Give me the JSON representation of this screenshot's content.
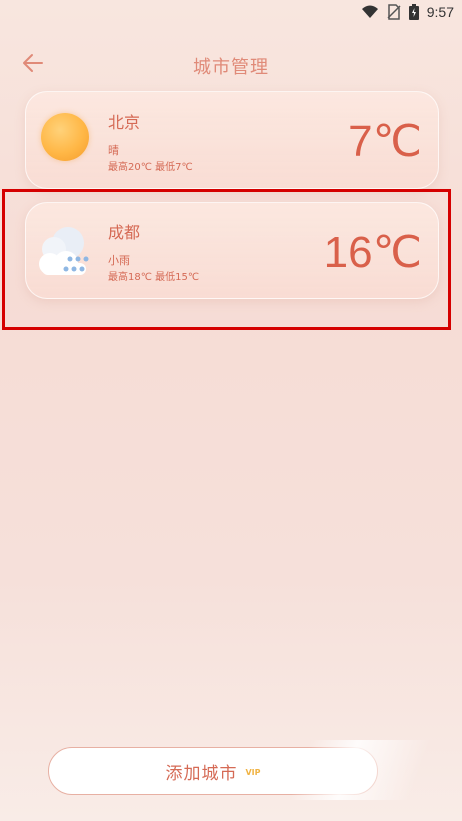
{
  "status_bar": {
    "time": "9:57"
  },
  "header": {
    "title": "城市管理"
  },
  "cities": [
    {
      "name": "北京",
      "condition": "晴",
      "range": "最高20℃ 最低7℃",
      "temp": "7℃",
      "icon": "sun-icon"
    },
    {
      "name": "成都",
      "condition": "小雨",
      "range": "最高18℃ 最低15℃",
      "temp": "16℃",
      "icon": "rain-cloud-icon"
    }
  ],
  "add_button": {
    "label": "添加城市",
    "badge": "VIP"
  },
  "colors": {
    "accent": "#d56a55",
    "highlight": "#d50000",
    "vip": "#f0b343"
  }
}
